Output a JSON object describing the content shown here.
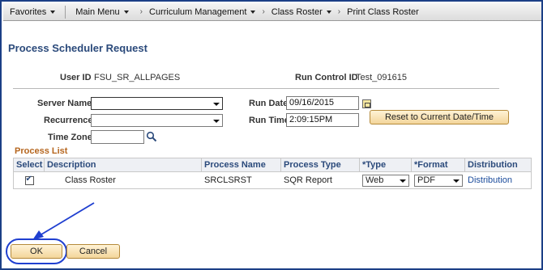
{
  "nav": {
    "favorites": "Favorites",
    "main_menu": "Main Menu",
    "crumbs": [
      "Curriculum Management",
      "Class Roster",
      "Print Class Roster"
    ]
  },
  "page": {
    "title": "Process Scheduler Request",
    "user_id_label": "User ID",
    "user_id_value": "FSU_SR_ALLPAGES",
    "run_control_label": "Run Control ID",
    "run_control_value": "Test_091615"
  },
  "form": {
    "server_name_label": "Server Name",
    "server_name_value": "",
    "recurrence_label": "Recurrence",
    "recurrence_value": "",
    "time_zone_label": "Time Zone",
    "time_zone_value": "",
    "run_date_label": "Run Date",
    "run_date_value": "09/16/2015",
    "run_time_label": "Run Time",
    "run_time_value": "2:09:15PM",
    "reset_button": "Reset to Current Date/Time"
  },
  "process_list": {
    "title": "Process List",
    "columns": [
      "Select",
      "Description",
      "Process Name",
      "Process Type",
      "*Type",
      "*Format",
      "Distribution"
    ],
    "rows": [
      {
        "selected": true,
        "description": "Class Roster",
        "process_name": "SRCLSRST",
        "process_type": "SQR Report",
        "type": "Web",
        "format": "PDF",
        "distribution": "Distribution"
      }
    ]
  },
  "actions": {
    "ok": "OK",
    "cancel": "Cancel"
  },
  "colors": {
    "title": "#2b4a7b",
    "section_title": "#b5651d",
    "annotation": "#1f3fd0"
  }
}
